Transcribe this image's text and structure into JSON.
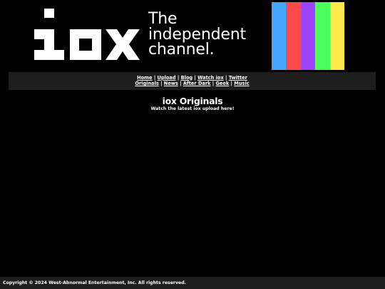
{
  "header": {
    "logo_text": "iox",
    "tagline_lines": [
      "The",
      "independent",
      "channel."
    ],
    "color_bars": [
      "#45a6ff",
      "#ff4a4a",
      "#9b45ff",
      "#4cff5a",
      "#ffe84a"
    ]
  },
  "nav": {
    "row1": [
      {
        "label": "Home",
        "name": "nav-link-home"
      },
      {
        "label": "Upload",
        "name": "nav-link-upload"
      },
      {
        "label": "Blog",
        "name": "nav-link-blog"
      },
      {
        "label": "Watch iox",
        "name": "nav-link-watch-iox"
      },
      {
        "label": "Twitter",
        "name": "nav-link-twitter"
      }
    ],
    "row2": [
      {
        "label": "Originals",
        "name": "nav-link-originals"
      },
      {
        "label": "News",
        "name": "nav-link-news"
      },
      {
        "label": "After Dark",
        "name": "nav-link-after-dark"
      },
      {
        "label": "Geek",
        "name": "nav-link-geek"
      },
      {
        "label": "Music",
        "name": "nav-link-music"
      }
    ],
    "separator": "|"
  },
  "main": {
    "title": "iox Originals",
    "subtitle": "Watch the latest iox upload here!"
  },
  "footer": {
    "copyright": "Copyright © 2024 West-Abnormal Entertainment, Inc. All rights reserved."
  }
}
